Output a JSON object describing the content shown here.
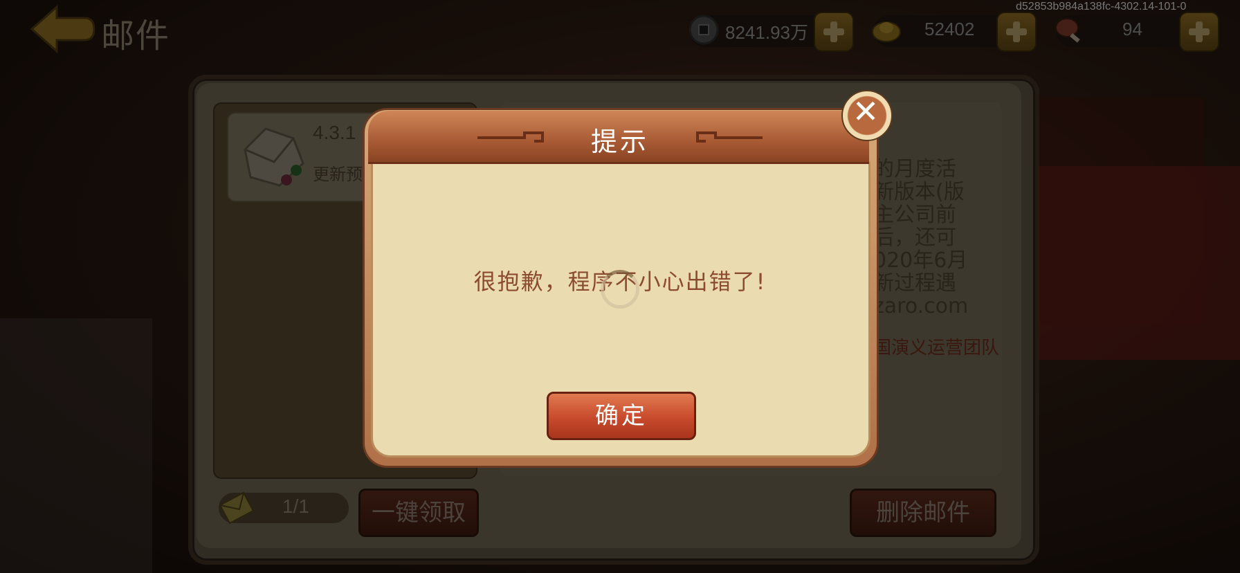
{
  "header": {
    "back_label": "back",
    "title": "邮件",
    "build_id": "d52853b984a138fc-4302.14-101-0",
    "resources": [
      {
        "icon": "copper-coin-icon",
        "value": "8241.93万"
      },
      {
        "icon": "gold-ingot-icon",
        "value": "52402"
      },
      {
        "icon": "meat-icon",
        "value": "94"
      }
    ]
  },
  "mail": {
    "item_title": "4.3.1",
    "item_subtitle": "更新预",
    "detail_text": "的月度活\n新版本(版\n主公司前\n后，还可\n020年6月\n新过程遇\nzaro.com",
    "detail_sign": "国演义运营团队",
    "count": "1/1",
    "claim_all_label": "一键领取",
    "delete_label": "删除邮件"
  },
  "dialog": {
    "title": "提示",
    "message": "很抱歉，程序不小心出错了!",
    "confirm_label": "确定"
  },
  "colors": {
    "dialog_header": "#a85a34",
    "dialog_body": "#eadcb0",
    "confirm_button": "#c84a2c",
    "message_text": "#8c4a30"
  }
}
